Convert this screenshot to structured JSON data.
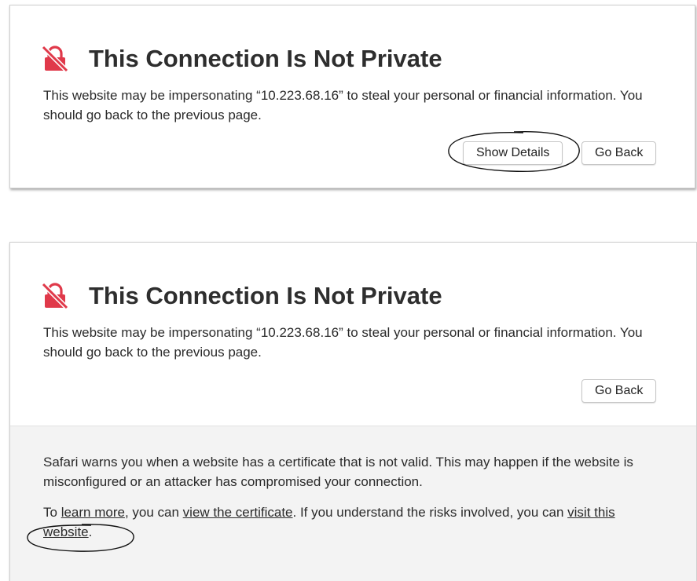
{
  "top_dialog": {
    "title": "This Connection Is Not Private",
    "description": "This website may be impersonating “10.223.68.16” to steal your personal or financial information. You should go back to the previous page.",
    "show_details_label": "Show Details",
    "go_back_label": "Go Back"
  },
  "bottom_dialog": {
    "title": "This Connection Is Not Private",
    "description": "This website may be impersonating “10.223.68.16” to steal your personal or financial information. You should go back to the previous page.",
    "go_back_label": "Go Back",
    "details": {
      "paragraph1": "Safari warns you when a website has a certificate that is not valid. This may happen if the website is misconfigured or an attacker has compromised your connection.",
      "p2_prefix": "To ",
      "learn_more_link": "learn more",
      "p2_mid1": ", you can ",
      "view_certificate_link": "view the certificate",
      "p2_mid2": ". If you understand the risks involved, you can ",
      "visit_website_link": "visit this website",
      "p2_suffix": "."
    }
  },
  "icons": {
    "warning_icon": "not-private-lock-icon",
    "icon_color": "#e0394a"
  }
}
